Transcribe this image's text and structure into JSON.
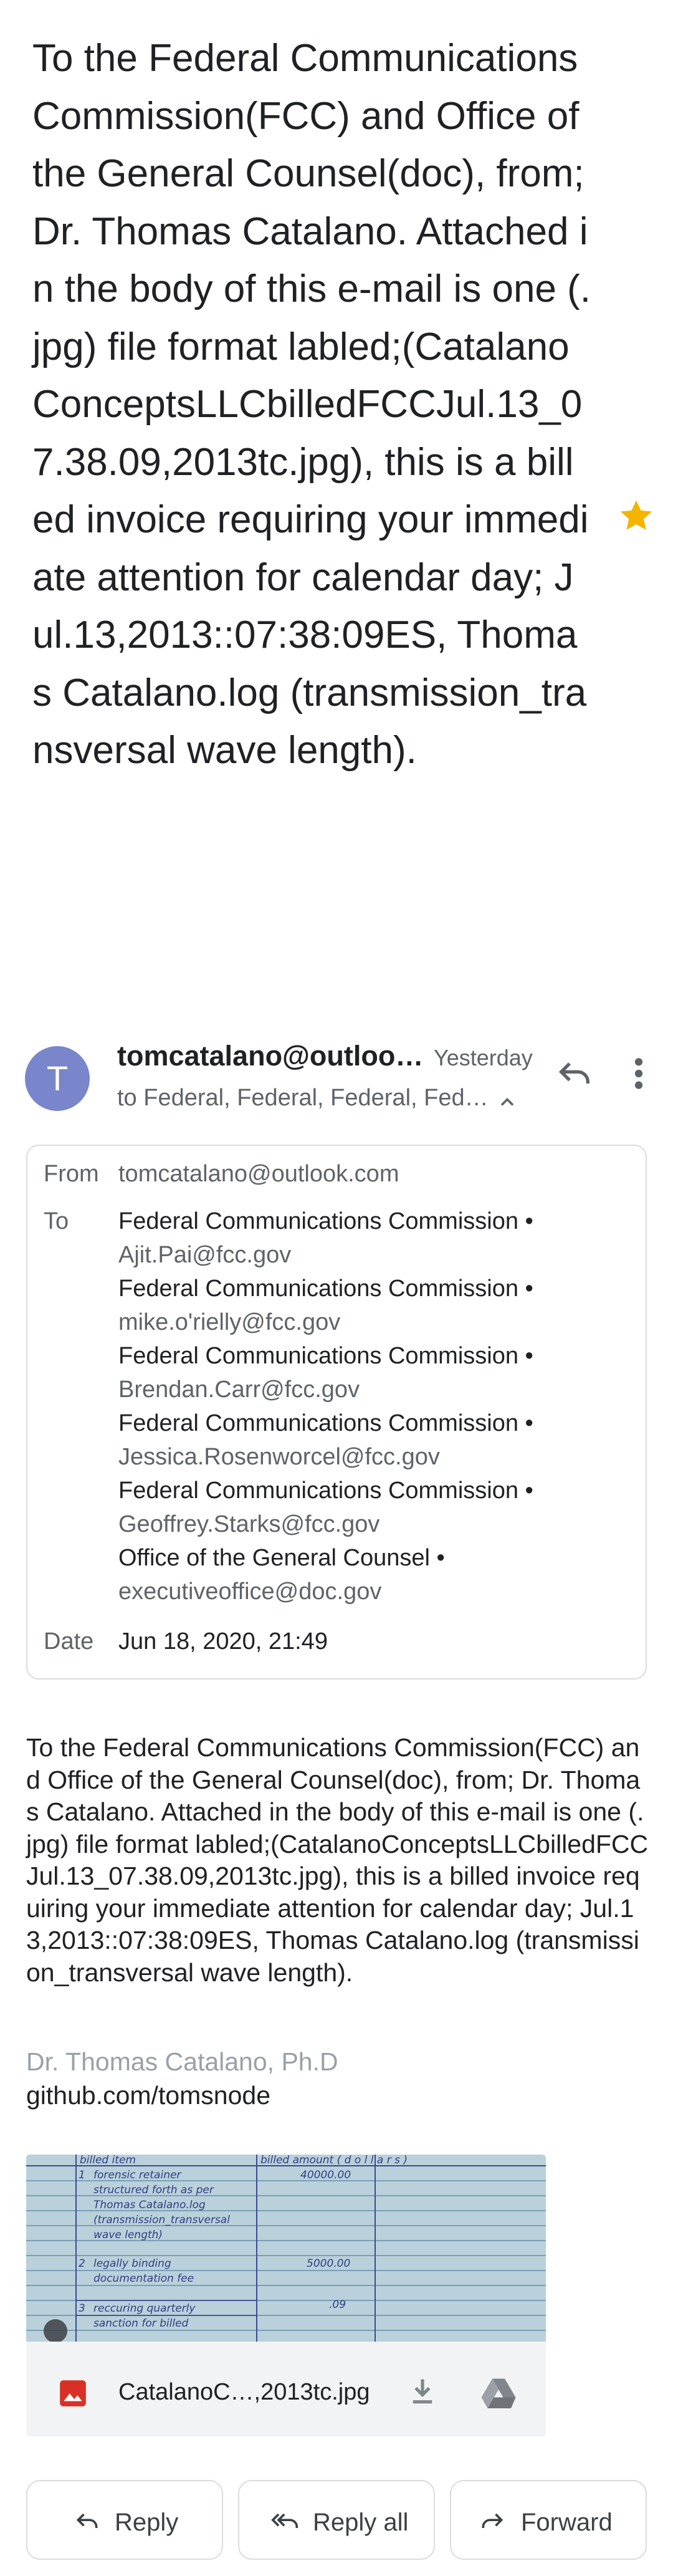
{
  "subject": "To the Federal Communications Commission(FCC) and Office of the General Counsel(doc), from; Dr. Thomas Catalano. Attached in the body of this e-mail is one (.jpg) file format labled;(CatalanoConceptsLLCbilledFCCJul.13_07.38.09,2013tc.jpg), this is a billed invoice requiring your immediate attention for calendar day; Jul.13,2013::07:38:09ES, Thomas Catalano.log (transmission_transversal wave length).",
  "sender": {
    "avatar_letter": "T",
    "name": "tomcatalano@outloo…",
    "time": "Yesterday",
    "to_summary": "to Federal, Federal, Federal, Fed…"
  },
  "details": {
    "from_label": "From",
    "from_value": "tomcatalano@outlook.com",
    "to_label": "To",
    "recipients": [
      {
        "name": "Federal Communications Commission •",
        "email": "Ajit.Pai@fcc.gov"
      },
      {
        "name": "Federal Communications Commission •",
        "email": "mike.o'rielly@fcc.gov"
      },
      {
        "name": "Federal Communications Commission •",
        "email": "Brendan.Carr@fcc.gov"
      },
      {
        "name": "Federal Communications Commission •",
        "email": "Jessica.Rosenworcel@fcc.gov"
      },
      {
        "name": "Federal Communications Commission •",
        "email": "Geoffrey.Starks@fcc.gov"
      },
      {
        "name": "Office of the General Counsel •",
        "email": "executiveoffice@doc.gov"
      }
    ],
    "date_label": "Date",
    "date_value": "Jun 18, 2020, 21:49"
  },
  "body": "To the Federal Communications Commission(FCC) and Office of the General Counsel(doc), from; Dr. Thomas Catalano. Attached in the body of this e-mail is one (.jpg) file format labled;(CatalanoConceptsLLCbilledFCCJul.13_07.38.09,2013tc.jpg), this is a billed invoice requiring your immediate attention for calendar day; Jul.13,2013::07:38:09ES, Thomas Catalano.log (transmission_transversal wave length).",
  "signature": {
    "name": "Dr. Thomas Catalano, Ph.D",
    "link": "github.com/tomsnode"
  },
  "attachment": {
    "filename": "CatalanoC…,2013tc.jpg",
    "preview": {
      "col_item": "billed item",
      "col_amount": "billed amount ( d o l l a r s )",
      "rows": [
        {
          "num": "1",
          "lines": [
            "forensic retainer",
            "structured forth as per",
            "Thomas Catalano.log",
            "(transmission_transversal",
            "wave length)"
          ],
          "amount": "40000.00"
        },
        {
          "num": "2",
          "lines": [
            "legally binding",
            "documentation fee"
          ],
          "amount": "5000.00"
        },
        {
          "num": "3",
          "lines": [
            "reccuring quarterly",
            "sanction for billed"
          ],
          "amount": ".09"
        }
      ]
    }
  },
  "actions": {
    "reply": "Reply",
    "reply_all": "Reply all",
    "forward": "Forward"
  },
  "colors": {
    "avatar": "#7986cb",
    "star": "#f4b400",
    "image_icon": "#d93025",
    "text_secondary": "#5f6368"
  }
}
